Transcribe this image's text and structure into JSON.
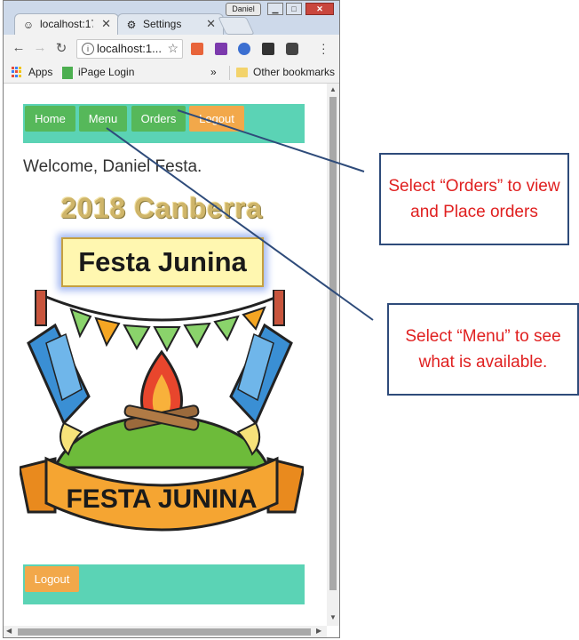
{
  "browser": {
    "user_badge": "Daniel",
    "tabs": [
      {
        "label": "localhost:171",
        "active": true
      },
      {
        "label": "Settings",
        "active": false
      }
    ],
    "address": "localhost:1...",
    "bookmarks": {
      "apps": "Apps",
      "ipage": "iPage Login",
      "more": "»",
      "other": "Other bookmarks"
    }
  },
  "page": {
    "nav": {
      "home": "Home",
      "menu": "Menu",
      "orders": "Orders",
      "logout": "Logout"
    },
    "welcome": "Welcome, Daniel Festa.",
    "hero_title": "2018 Canberra",
    "hero_subtitle": "Festa Junina",
    "banner_text": "FESTA JUNINA",
    "footer_logout": "Logout"
  },
  "callouts": {
    "orders": "Select “Orders” to view and Place orders",
    "menu": "Select “Menu” to see what is available."
  },
  "colors": {
    "navbar_bg": "#5bd3b5",
    "btn_green": "#56b85a",
    "btn_orange": "#f2a84a",
    "callout_text": "#e02020",
    "callout_border": "#2e4b7a"
  }
}
